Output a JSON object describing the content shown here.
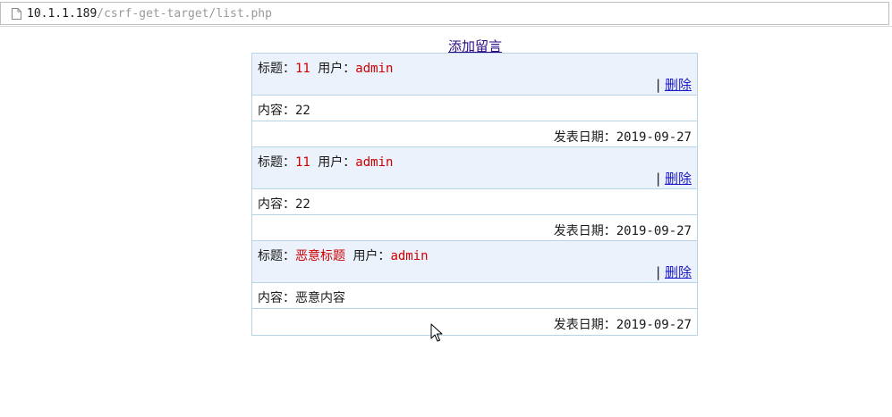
{
  "address_bar": {
    "host": "10.1.1.189",
    "path": "/csrf-get-target/list.php"
  },
  "add_link_label": "添加留言",
  "labels": {
    "title_prefix": "标题：",
    "user_prefix": "用户：",
    "content_prefix": "内容：",
    "date_prefix": "发表日期：",
    "separator": "|",
    "delete_label": "删除"
  },
  "messages": [
    {
      "title": "11",
      "user": "admin",
      "content": "22",
      "date": "2019-09-27"
    },
    {
      "title": "11",
      "user": "admin",
      "content": "22",
      "date": "2019-09-27"
    },
    {
      "title": "恶意标题",
      "user": "admin",
      "content": "恶意内容",
      "date": "2019-09-27"
    }
  ],
  "colors": {
    "accent_red": "#cc0000",
    "header_bg": "#ecf2fc",
    "border": "#b7d3e6",
    "link": "#1a1ac8"
  },
  "icons": {
    "page": "page-icon",
    "cursor": "mouse-cursor-icon"
  }
}
